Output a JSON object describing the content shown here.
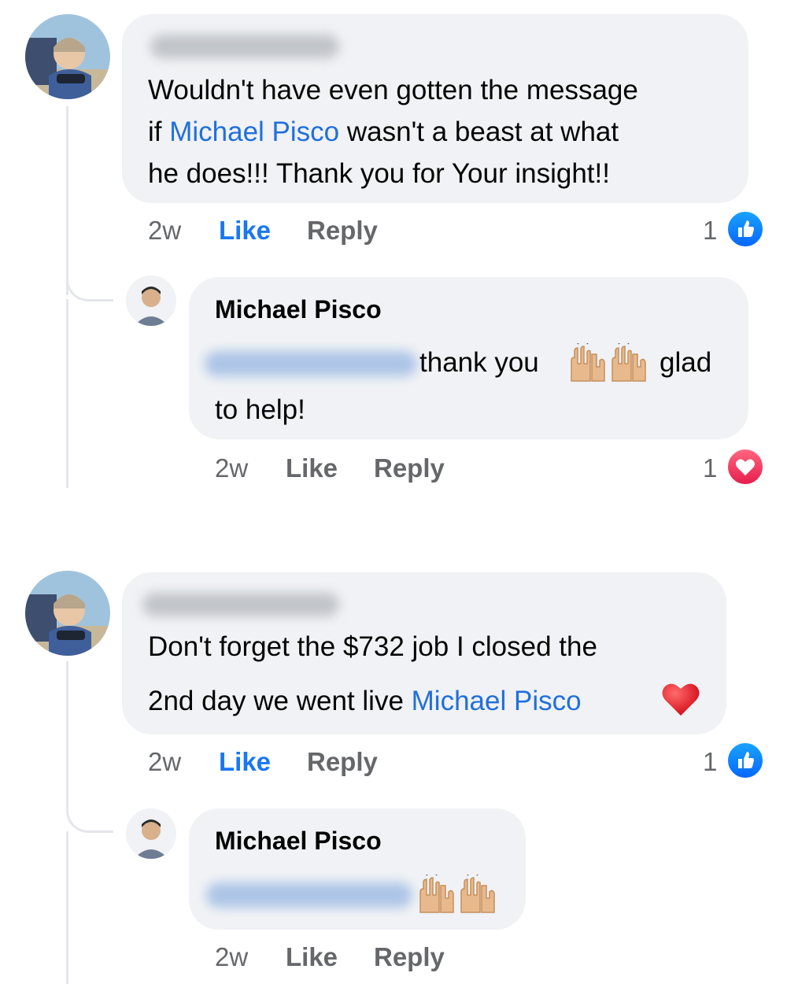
{
  "thread_1": {
    "comment": {
      "text_part1": "Wouldn't have even gotten the message",
      "text_part2_prefix": "if ",
      "mention": "Michael Pisco",
      "text_part2_suffix": " wasn't a beast at what",
      "text_part3": "he does!!! Thank you for Your insight!!",
      "time": "2w",
      "like_label": "Like",
      "reply_label": "Reply",
      "reaction_count": "1",
      "reaction_type": "like-icon"
    },
    "reply": {
      "author": "Michael Pisco",
      "text_part1": "thank you",
      "text_part2": "glad",
      "text_part3": "to help!",
      "emoji": "raising-hands-icon",
      "time": "2w",
      "like_label": "Like",
      "reply_label": "Reply",
      "reaction_count": "1",
      "reaction_type": "love-icon"
    }
  },
  "thread_2": {
    "comment": {
      "text_part1": "Don't forget the $732 job I closed the",
      "text_part2_prefix": "2nd day we went live ",
      "mention": "Michael Pisco",
      "emoji": "heart-icon",
      "time": "2w",
      "like_label": "Like",
      "reply_label": "Reply",
      "reaction_count": "1",
      "reaction_type": "like-icon"
    },
    "reply": {
      "author": "Michael Pisco",
      "emoji": "raising-hands-icon",
      "time": "2w",
      "like_label": "Like",
      "reply_label": "Reply"
    }
  },
  "colors": {
    "mention": "#216fdb",
    "like_active": "#1877f2",
    "meta_gray": "#65676b",
    "bubble_bg": "#f0f2f5",
    "love_red": "#e61e4d",
    "like_blue": "#0866ff"
  }
}
